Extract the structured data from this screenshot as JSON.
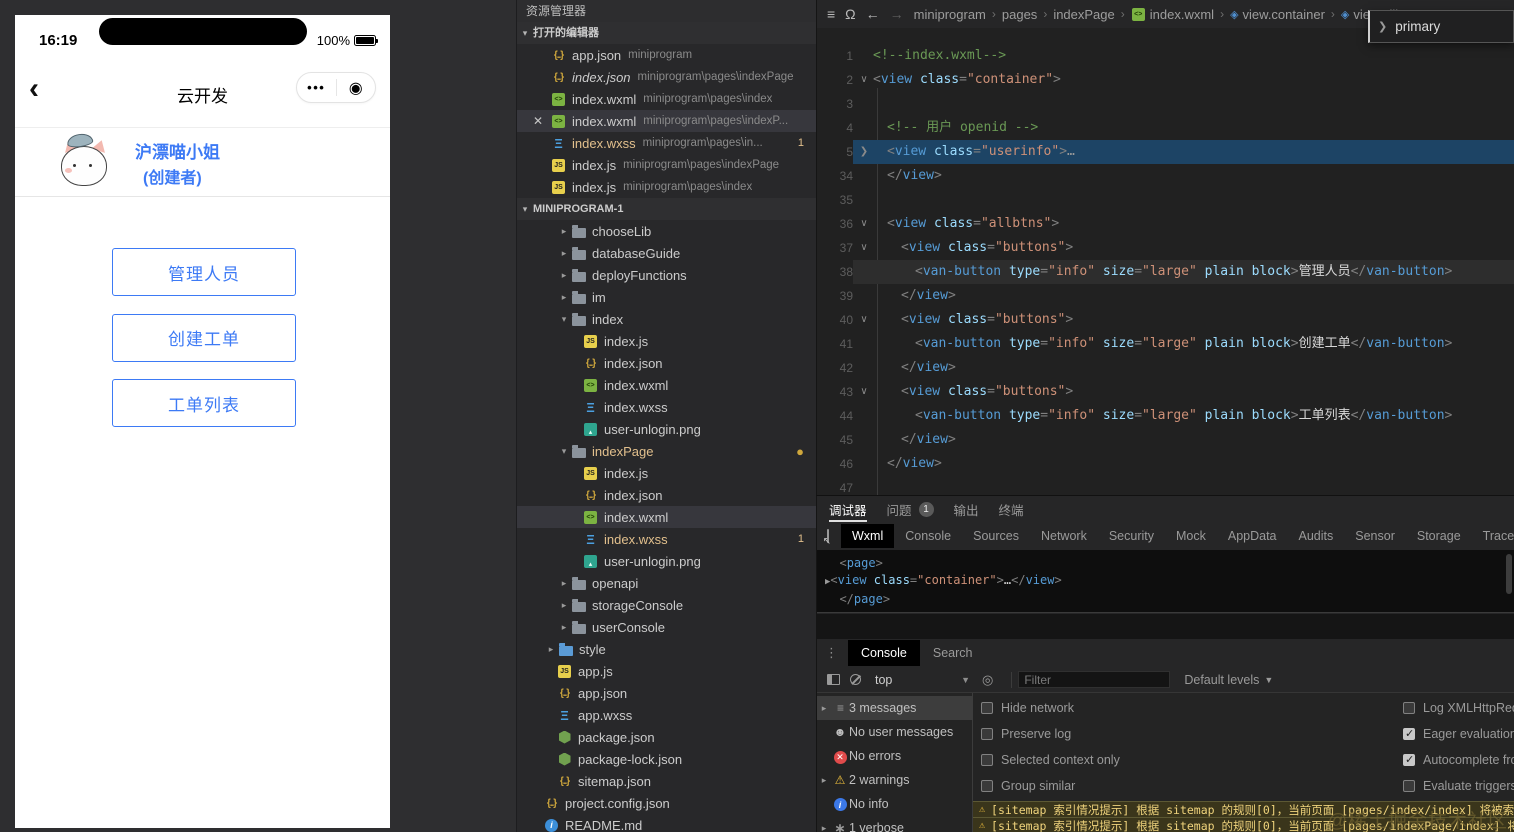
{
  "palette": {
    "accent_blue": "#3d7af5",
    "modified_yellow": "#e2c08d",
    "warning_bg": "#3a351b",
    "warning_text": "#efd37c",
    "selection_blue": "#1d4465"
  },
  "phone": {
    "time": "16:19",
    "battery": "100%",
    "nav_title": "云开发",
    "back_icon": "‹",
    "capsule": {
      "more_icon": "•••",
      "target_icon": "◉"
    },
    "user_name": "沪漂喵小姐",
    "user_role": "(创建者)",
    "buttons": [
      "管理人员",
      "创建工单",
      "工单列表"
    ]
  },
  "explorer": {
    "title": "资源管理器",
    "open_editors_label": "打开的编辑器",
    "open_editors": [
      {
        "icon": "json",
        "name": "app.json",
        "path": "miniprogram"
      },
      {
        "icon": "json",
        "name": "index.json",
        "path": "miniprogram\\pages\\indexPage",
        "italic": true
      },
      {
        "icon": "wxml",
        "name": "index.wxml",
        "path": "miniprogram\\pages\\index"
      },
      {
        "icon": "wxml",
        "name": "index.wxml",
        "path": "miniprogram\\pages\\indexP...",
        "selected": true,
        "close": true
      },
      {
        "icon": "wxss",
        "name": "index.wxss",
        "path": "miniprogram\\pages\\in...",
        "modified": true,
        "badge": "1"
      },
      {
        "icon": "js",
        "name": "index.js",
        "path": "miniprogram\\pages\\indexPage"
      },
      {
        "icon": "js",
        "name": "index.js",
        "path": "miniprogram\\pages\\index"
      }
    ],
    "project_label": "MINIPROGRAM-1",
    "tree": [
      {
        "name": "chooseLib",
        "icon": "folder",
        "level": 3,
        "arrow": "closed"
      },
      {
        "name": "databaseGuide",
        "icon": "folder",
        "level": 3,
        "arrow": "closed"
      },
      {
        "name": "deployFunctions",
        "icon": "folder",
        "level": 3,
        "arrow": "closed"
      },
      {
        "name": "im",
        "icon": "folder",
        "level": 3,
        "arrow": "closed"
      },
      {
        "name": "index",
        "icon": "folder",
        "level": 3,
        "arrow": "open"
      },
      {
        "name": "index.js",
        "icon": "js",
        "level": 4
      },
      {
        "name": "index.json",
        "icon": "json",
        "level": 4
      },
      {
        "name": "index.wxml",
        "icon": "wxml",
        "level": 4
      },
      {
        "name": "index.wxss",
        "icon": "wxss",
        "level": 4
      },
      {
        "name": "user-unlogin.png",
        "icon": "png",
        "level": 4
      },
      {
        "name": "indexPage",
        "icon": "folder",
        "level": 3,
        "arrow": "open",
        "modified": true,
        "dot": true
      },
      {
        "name": "index.js",
        "icon": "js",
        "level": 4
      },
      {
        "name": "index.json",
        "icon": "json",
        "level": 4
      },
      {
        "name": "index.wxml",
        "icon": "wxml",
        "level": 4,
        "selected": true
      },
      {
        "name": "index.wxss",
        "icon": "wxss",
        "level": 4,
        "modified": true,
        "badge": "1"
      },
      {
        "name": "user-unlogin.png",
        "icon": "png",
        "level": 4
      },
      {
        "name": "openapi",
        "icon": "folder",
        "level": 3,
        "arrow": "closed"
      },
      {
        "name": "storageConsole",
        "icon": "folder",
        "level": 3,
        "arrow": "closed"
      },
      {
        "name": "userConsole",
        "icon": "folder",
        "level": 3,
        "arrow": "closed"
      },
      {
        "name": "style",
        "icon": "folder-blue",
        "level": 2,
        "arrow": "closed"
      },
      {
        "name": "app.js",
        "icon": "js",
        "level": 2
      },
      {
        "name": "app.json",
        "icon": "json",
        "level": 2
      },
      {
        "name": "app.wxss",
        "icon": "wxss",
        "level": 2
      },
      {
        "name": "package.json",
        "icon": "pkg",
        "level": 2
      },
      {
        "name": "package-lock.json",
        "icon": "pkg",
        "level": 2
      },
      {
        "name": "sitemap.json",
        "icon": "json",
        "level": 2
      },
      {
        "name": "project.config.json",
        "icon": "json",
        "level": 1
      },
      {
        "name": "README.md",
        "icon": "info",
        "level": 1
      }
    ]
  },
  "editor": {
    "toolbar_icons": [
      "menu",
      "bookmark",
      "back",
      "forward"
    ],
    "breadcrumb": [
      {
        "label": "miniprogram"
      },
      {
        "label": "pages"
      },
      {
        "label": "indexPage"
      },
      {
        "label": "index.wxml",
        "icon": "wxml"
      },
      {
        "label": "view.container",
        "icon": "view"
      },
      {
        "label": "view.allbtns",
        "icon": "view"
      }
    ],
    "popup": {
      "label": "primary",
      "chevron": "❯"
    },
    "van_attrs": {
      "pairs": [
        [
          "type",
          "info"
        ],
        [
          "size",
          "large"
        ]
      ],
      "flags": [
        "plain",
        "block"
      ]
    },
    "lines": [
      {
        "n": "1",
        "kind": "cm",
        "text": "<!--index.wxml-->"
      },
      {
        "n": "2",
        "kind": "vo",
        "cls": "container",
        "fold": "open"
      },
      {
        "n": "3",
        "kind": "empty"
      },
      {
        "n": "4",
        "ind": 1,
        "kind": "cm",
        "text": "<!-- 用户 openid -->"
      },
      {
        "n": "5",
        "ind": 1,
        "kind": "vo",
        "cls": "userinfo",
        "fold": "closed",
        "hl": "sel",
        "ell": true
      },
      {
        "n": "34",
        "ind": 1,
        "kind": "vc"
      },
      {
        "n": "35",
        "kind": "empty"
      },
      {
        "n": "36",
        "ind": 1,
        "kind": "vo",
        "cls": "allbtns",
        "fold": "open"
      },
      {
        "n": "37",
        "ind": 2,
        "kind": "vo",
        "cls": "buttons",
        "fold": "open"
      },
      {
        "n": "38",
        "ind": 3,
        "kind": "van",
        "label": "管理人员",
        "hl": "cur"
      },
      {
        "n": "39",
        "ind": 2,
        "kind": "vc"
      },
      {
        "n": "40",
        "ind": 2,
        "kind": "vo",
        "cls": "buttons",
        "fold": "open"
      },
      {
        "n": "41",
        "ind": 3,
        "kind": "van",
        "label": "创建工单"
      },
      {
        "n": "42",
        "ind": 2,
        "kind": "vc"
      },
      {
        "n": "43",
        "ind": 2,
        "kind": "vo",
        "cls": "buttons",
        "fold": "open"
      },
      {
        "n": "44",
        "ind": 3,
        "kind": "van",
        "label": "工单列表"
      },
      {
        "n": "45",
        "ind": 2,
        "kind": "vc"
      },
      {
        "n": "46",
        "ind": 1,
        "kind": "vc"
      },
      {
        "n": "47",
        "kind": "empty"
      }
    ]
  },
  "debugger": {
    "tabs": [
      {
        "label": "调试器",
        "active": true
      },
      {
        "label": "问题",
        "badge": "1"
      },
      {
        "label": "输出"
      },
      {
        "label": "终端"
      }
    ],
    "devtool_tabs": [
      "Wxml",
      "Console",
      "Sources",
      "Network",
      "Security",
      "Mock",
      "AppData",
      "Audits",
      "Sensor",
      "Storage",
      "Trace"
    ],
    "devtool_active": "Wxml",
    "wxml_pane": [
      {
        "kind": "open",
        "tag": "page"
      },
      {
        "kind": "view",
        "tag": "view",
        "attr": "class",
        "value": "container",
        "ellipsis": "…",
        "arrow": true
      },
      {
        "kind": "close",
        "tag": "page"
      }
    ]
  },
  "console": {
    "tabs": [
      {
        "label": "Console",
        "active": true
      },
      {
        "label": "Search"
      }
    ],
    "context": "top",
    "filter_placeholder": "Filter",
    "levels_label": "Default levels",
    "sidebar": [
      {
        "icon": "list",
        "label": "3 messages",
        "arrow": true,
        "selected": true
      },
      {
        "icon": "user",
        "label": "No user messages"
      },
      {
        "icon": "error",
        "label": "No errors"
      },
      {
        "icon": "warn",
        "label": "2 warnings",
        "arrow": true
      },
      {
        "icon": "info",
        "label": "No info"
      },
      {
        "icon": "verbose",
        "label": "1 verbose",
        "arrow": true
      }
    ],
    "options_left": [
      {
        "label": "Hide network",
        "checked": false
      },
      {
        "label": "Preserve log",
        "checked": false
      },
      {
        "label": "Selected context only",
        "checked": false
      },
      {
        "label": "Group similar",
        "checked": false
      }
    ],
    "options_right": [
      {
        "label": "Log XMLHttpRequ",
        "checked": false
      },
      {
        "label": "Eager evaluation",
        "checked": true
      },
      {
        "label": "Autocomplete fro",
        "checked": true
      },
      {
        "label": "Evaluate triggers u",
        "checked": false
      }
    ],
    "warnings": [
      "[sitemap 索引情况提示] 根据 sitemap 的规则[0]，当前页面 [pages/index/index] 将被索",
      "[sitemap 索引情况提示] 根据 sitemap 的规则[0]，当前页面 [pages/indexPage/index] 将"
    ]
  },
  "watermark": "@稀土掘金技术社区"
}
